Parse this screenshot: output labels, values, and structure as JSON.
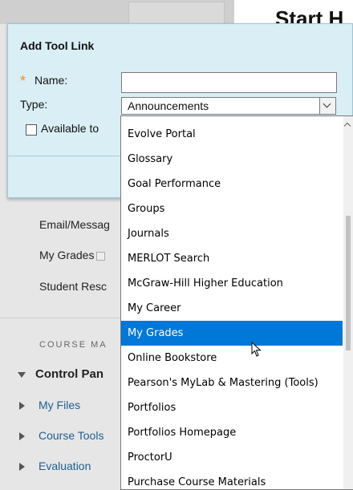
{
  "background": {
    "main_title": "Start H",
    "nav_items": [
      {
        "label": "Email/Messag"
      },
      {
        "label": "My Grades"
      },
      {
        "label": "Student Resc"
      }
    ],
    "section_label": "COURSE MA",
    "control_panel": "Control Pan",
    "tree_items": [
      {
        "label": "My Files"
      },
      {
        "label": "Course Tools"
      },
      {
        "label": "Evaluation"
      }
    ]
  },
  "dialog": {
    "title": "Add Tool Link",
    "required_marker": "*",
    "name_label": "Name:",
    "name_value": "",
    "type_label": "Type:",
    "type_selected": "Announcements",
    "available_label": "Available to",
    "available_checked": false
  },
  "dropdown": {
    "items": [
      "Evolve Portal",
      "Glossary",
      "Goal Performance",
      "Groups",
      "Journals",
      "MERLOT Search",
      "McGraw-Hill Higher Education",
      "My Career",
      "My Grades",
      "Online Bookstore",
      "Pearson's MyLab & Mastering (Tools)",
      "Portfolios",
      "Portfolios Homepage",
      "ProctorU",
      "Purchase Course Materials"
    ],
    "highlighted": "My Grades"
  },
  "colors": {
    "panel_bg": "#d9eef5",
    "highlight": "#0078d7",
    "required": "#f29020",
    "link": "#1f5f8f"
  }
}
